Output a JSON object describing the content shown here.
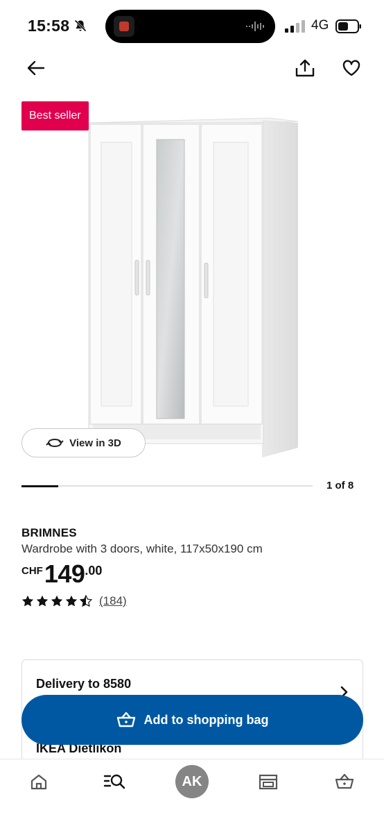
{
  "status_bar": {
    "time": "15:58",
    "network": "4G",
    "icons": [
      "bell-slash-icon",
      "signal-icon",
      "battery-icon"
    ]
  },
  "header": {
    "icons": [
      "arrow-left-icon",
      "share-icon",
      "heart-icon"
    ]
  },
  "gallery": {
    "badge": "Best seller",
    "view3d_label": "View in 3D",
    "counter": "1 of 8",
    "current_index": 1,
    "total_images": 8,
    "progress_fraction": 0.125
  },
  "product": {
    "name": "BRIMNES",
    "description": "Wardrobe with 3 doors, white, 117x50x190 cm",
    "price_currency": "CHF",
    "price_integer": "149",
    "price_decimal": ".00",
    "rating": 4.5,
    "rating_max": 5,
    "review_count": "(184)"
  },
  "delivery": {
    "title": "Delivery to 8580",
    "store": "IKEA Dietlikon"
  },
  "cta": {
    "add_to_bag": "Add to shopping bag"
  },
  "bottom_nav": {
    "avatar_initials": "AK",
    "items": [
      "home-icon",
      "search-list-icon",
      "avatar",
      "store-icon",
      "basket-icon"
    ]
  },
  "colors": {
    "badge": "#e0004d",
    "primary": "#0058a3",
    "avatar": "#858585"
  }
}
